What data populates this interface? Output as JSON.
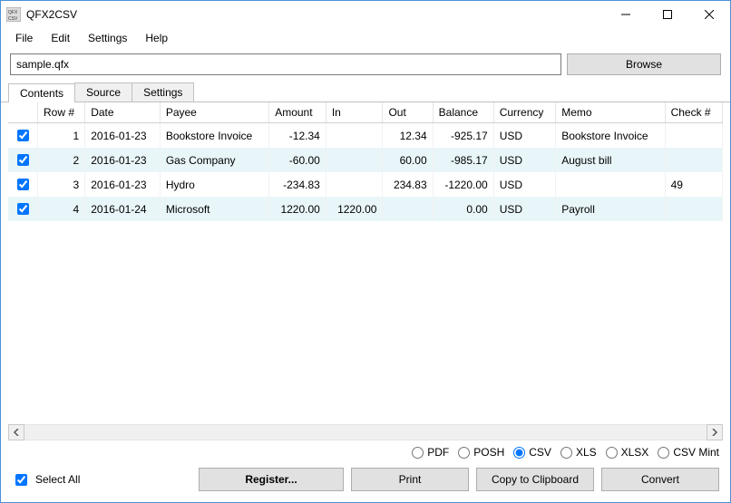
{
  "titlebar": {
    "title": "QFX2CSV"
  },
  "menubar": {
    "items": [
      "File",
      "Edit",
      "Settings",
      "Help"
    ]
  },
  "filerow": {
    "path": "sample.qfx",
    "browse": "Browse"
  },
  "tabs": {
    "items": [
      "Contents",
      "Source",
      "Settings"
    ],
    "active": 0
  },
  "table": {
    "headers": [
      "",
      "Row #",
      "Date",
      "Payee",
      "Amount",
      "In",
      "Out",
      "Balance",
      "Currency",
      "Memo",
      "Check #"
    ],
    "rows": [
      {
        "checked": true,
        "row": "1",
        "date": "2016-01-23",
        "payee": "Bookstore Invoice",
        "amount": "-12.34",
        "in": "",
        "out": "12.34",
        "balance": "-925.17",
        "currency": "USD",
        "memo": "Bookstore Invoice",
        "check": ""
      },
      {
        "checked": true,
        "row": "2",
        "date": "2016-01-23",
        "payee": "Gas Company",
        "amount": "-60.00",
        "in": "",
        "out": "60.00",
        "balance": "-985.17",
        "currency": "USD",
        "memo": "August bill",
        "check": ""
      },
      {
        "checked": true,
        "row": "3",
        "date": "2016-01-23",
        "payee": "Hydro",
        "amount": "-234.83",
        "in": "",
        "out": "234.83",
        "balance": "-1220.00",
        "currency": "USD",
        "memo": "",
        "check": "49"
      },
      {
        "checked": true,
        "row": "4",
        "date": "2016-01-24",
        "payee": "Microsoft",
        "amount": "1220.00",
        "in": "1220.00",
        "out": "",
        "balance": "0.00",
        "currency": "USD",
        "memo": "Payroll",
        "check": ""
      }
    ]
  },
  "formats": {
    "options": [
      "PDF",
      "POSH",
      "CSV",
      "XLS",
      "XLSX",
      "CSV Mint"
    ],
    "selected": "CSV"
  },
  "footer": {
    "select_all": "Select All",
    "select_all_checked": true,
    "register": "Register...",
    "print": "Print",
    "copy": "Copy to Clipboard",
    "convert": "Convert"
  }
}
